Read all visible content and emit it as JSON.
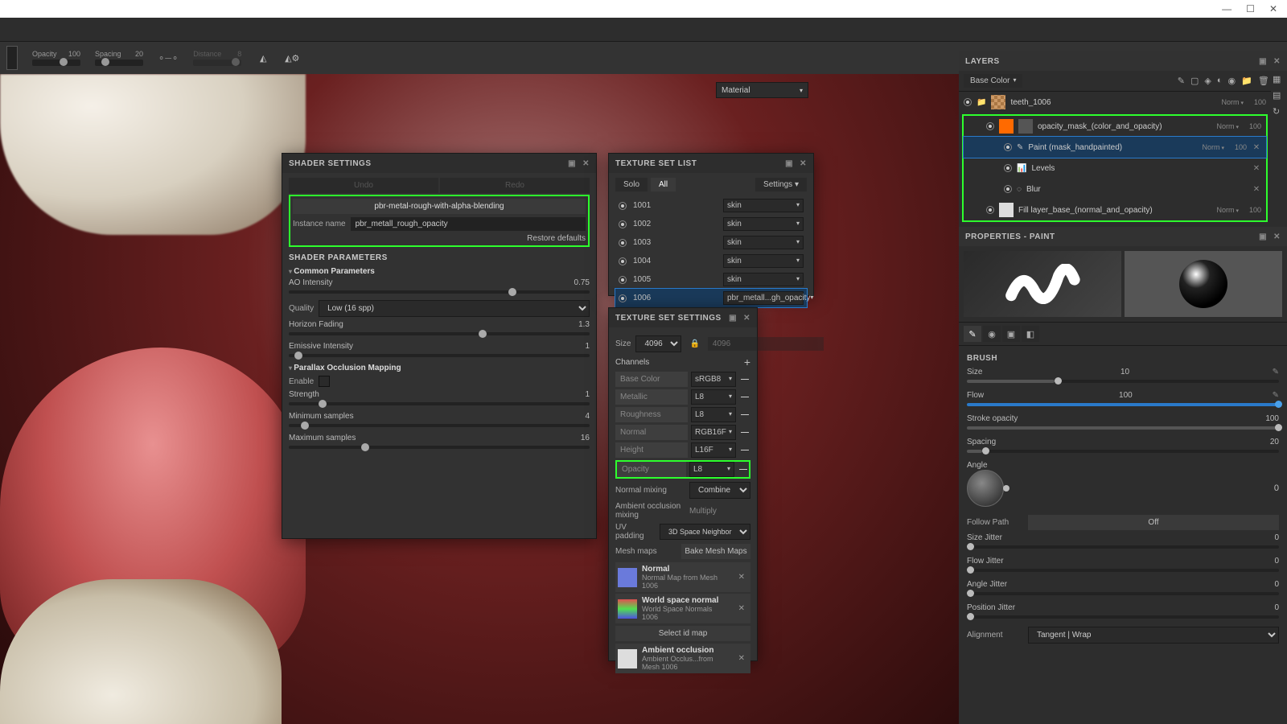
{
  "window_controls": {
    "min": "—",
    "max": "☐",
    "close": "✕"
  },
  "top_sliders": {
    "opacity": {
      "label": "Opacity",
      "value": "100"
    },
    "spacing": {
      "label": "Spacing",
      "value": "20"
    },
    "distance": {
      "label": "Distance",
      "value": "8"
    }
  },
  "material_dropdown": "Material",
  "shader_settings": {
    "title": "SHADER SETTINGS",
    "undo": "Undo",
    "redo": "Redo",
    "shader_name": "pbr-metal-rough-with-alpha-blending",
    "instance_label": "Instance name",
    "instance_name": "pbr_metall_rough_opacity",
    "restore": "Restore defaults",
    "params_title": "SHADER PARAMETERS",
    "group1": "Common Parameters",
    "ao": {
      "lbl": "AO Intensity",
      "val": "0.75"
    },
    "quality_lbl": "Quality",
    "quality_val": "Low (16 spp)",
    "horizon": {
      "lbl": "Horizon Fading",
      "val": "1.3"
    },
    "emissive": {
      "lbl": "Emissive Intensity",
      "val": "1"
    },
    "group2": "Parallax Occlusion Mapping",
    "enable": "Enable",
    "strength": {
      "lbl": "Strength",
      "val": "1"
    },
    "minsamp": {
      "lbl": "Minimum samples",
      "val": "4"
    },
    "maxsamp": {
      "lbl": "Maximum samples",
      "val": "16"
    }
  },
  "texture_set_list": {
    "title": "TEXTURE SET LIST",
    "solo": "Solo",
    "all": "All",
    "settings_btn": "Settings",
    "sets": [
      {
        "id": "1001",
        "shader": "skin"
      },
      {
        "id": "1002",
        "shader": "skin"
      },
      {
        "id": "1003",
        "shader": "skin"
      },
      {
        "id": "1004",
        "shader": "skin"
      },
      {
        "id": "1005",
        "shader": "skin"
      },
      {
        "id": "1006",
        "shader": "pbr_metall...gh_opacity"
      }
    ]
  },
  "texture_set_settings": {
    "title": "TEXTURE SET SETTINGS",
    "size_lbl": "Size",
    "size": "4096",
    "size2": "4096",
    "channels_lbl": "Channels",
    "channels": [
      {
        "name": "Base Color",
        "fmt": "sRGB8"
      },
      {
        "name": "Metallic",
        "fmt": "L8"
      },
      {
        "name": "Roughness",
        "fmt": "L8"
      },
      {
        "name": "Normal",
        "fmt": "RGB16F"
      },
      {
        "name": "Height",
        "fmt": "L16F"
      },
      {
        "name": "Opacity",
        "fmt": "L8"
      }
    ],
    "normal_mixing_lbl": "Normal mixing",
    "normal_mixing": "Combine",
    "ao_mixing_lbl": "Ambient occlusion mixing",
    "ao_mixing": "Multiply",
    "uv_padding_lbl": "UV padding",
    "uv_padding": "3D Space Neighbor",
    "mesh_maps_lbl": "Mesh maps",
    "bake_btn": "Bake Mesh Maps",
    "maps": [
      {
        "name": "Normal",
        "sub": "Normal Map from Mesh 1006",
        "color": "#6a7adb"
      },
      {
        "name": "World space normal",
        "sub": "World Space Normals 1006",
        "color": "linear-gradient(#e05050,#50e050,#5050e0)"
      },
      {
        "name": "Ambient occlusion",
        "sub": "Ambient Occlus...from Mesh 1006",
        "color": "#dddddd"
      }
    ],
    "select_id": "Select id map"
  },
  "layers": {
    "title": "LAYERS",
    "channel_dd": "Base Color",
    "items": [
      {
        "name": "teeth_1006",
        "blend": "Norm",
        "opac": "100",
        "thumb": "#cc9966",
        "indent": 0,
        "folder": true
      },
      {
        "name": "opacity_mask_(color_and_opacity)",
        "blend": "Norm",
        "opac": "100",
        "thumb": "#ff6a00",
        "thumb2": "#555",
        "indent": 1
      },
      {
        "name": "Paint (mask_handpainted)",
        "blend": "Norm",
        "opac": "100",
        "indent": 2,
        "icon": "brush",
        "selected": true
      },
      {
        "name": "Levels",
        "indent": 2,
        "icon": "levels"
      },
      {
        "name": "Blur",
        "indent": 2,
        "icon": "blur"
      },
      {
        "name": "Fill layer_base_(normal_and_opacity)",
        "blend": "Norm",
        "opac": "100",
        "thumb": "#ddd",
        "indent": 1
      }
    ]
  },
  "properties": {
    "title": "PROPERTIES - PAINT",
    "brush_title": "BRUSH",
    "size": {
      "lbl": "Size",
      "val": "10"
    },
    "flow": {
      "lbl": "Flow",
      "val": "100"
    },
    "stroke_op": {
      "lbl": "Stroke opacity",
      "val": "100"
    },
    "spacing": {
      "lbl": "Spacing",
      "val": "20"
    },
    "angle": {
      "lbl": "Angle",
      "val": "0"
    },
    "follow_path": {
      "lbl": "Follow Path",
      "val": "Off"
    },
    "size_jitter": {
      "lbl": "Size Jitter",
      "val": "0"
    },
    "flow_jitter": {
      "lbl": "Flow Jitter",
      "val": "0"
    },
    "angle_jitter": {
      "lbl": "Angle Jitter",
      "val": "0"
    },
    "pos_jitter": {
      "lbl": "Position Jitter",
      "val": "0"
    },
    "alignment_lbl": "Alignment",
    "alignment": "Tangent | Wrap"
  }
}
